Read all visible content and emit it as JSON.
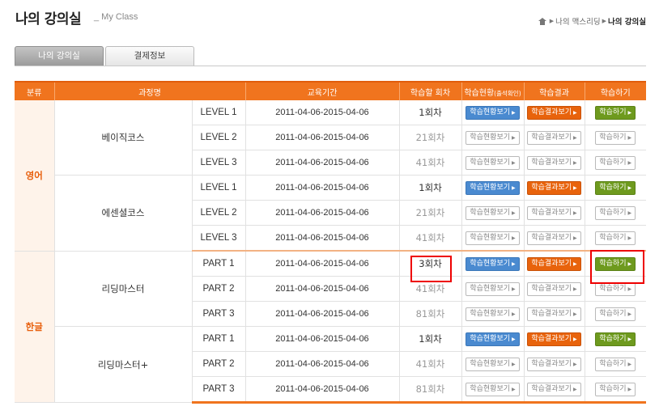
{
  "header": {
    "title": "나의 강의실",
    "subtitle": "_ My Class"
  },
  "breadcrumb": {
    "sep": "▶",
    "items": [
      "나의 맥스리딩",
      "나의 강의실"
    ]
  },
  "tabs": [
    "나의 강의실",
    "결제정보"
  ],
  "table": {
    "columns": [
      "분류",
      "과정명",
      "",
      "교육기간",
      "학습할 회차",
      "학습현황",
      "(출석확인)",
      "학습결과",
      "학습하기"
    ],
    "buttons": {
      "status": "학습현황보기",
      "result": "학습결과보기",
      "study": "학습하기"
    },
    "categories": [
      "영어",
      "한글"
    ],
    "courses": [
      "베이직코스",
      "에센셜코스",
      "리딩마스터",
      "리딩마스터+"
    ],
    "rows": [
      {
        "level": "LEVEL 1",
        "period": "2011-04-06-2015-04-06",
        "session": "1회차",
        "active": true
      },
      {
        "level": "LEVEL 2",
        "period": "2011-04-06-2015-04-06",
        "session": "21회차",
        "active": false
      },
      {
        "level": "LEVEL 3",
        "period": "2011-04-06-2015-04-06",
        "session": "41회차",
        "active": false
      },
      {
        "level": "LEVEL 1",
        "period": "2011-04-06-2015-04-06",
        "session": "1회차",
        "active": true
      },
      {
        "level": "LEVEL 2",
        "period": "2011-04-06-2015-04-06",
        "session": "21회차",
        "active": false
      },
      {
        "level": "LEVEL 3",
        "period": "2011-04-06-2015-04-06",
        "session": "41회차",
        "active": false
      },
      {
        "level": "PART 1",
        "period": "2011-04-06-2015-04-06",
        "session": "3회차",
        "active": true
      },
      {
        "level": "PART 2",
        "period": "2011-04-06-2015-04-06",
        "session": "41회차",
        "active": false
      },
      {
        "level": "PART 3",
        "period": "2011-04-06-2015-04-06",
        "session": "81회차",
        "active": false
      },
      {
        "level": "PART 1",
        "period": "2011-04-06-2015-04-06",
        "session": "1회차",
        "active": true
      },
      {
        "level": "PART 2",
        "period": "2011-04-06-2015-04-06",
        "session": "41회차",
        "active": false
      },
      {
        "level": "PART 3",
        "period": "2011-04-06-2015-04-06",
        "session": "81회차",
        "active": false
      }
    ]
  },
  "colors": {
    "accent": "#f0741e",
    "blue": "#4a8ad0",
    "orange": "#e8630c",
    "green": "#6e9a1e",
    "highlight": "#ee0000"
  }
}
